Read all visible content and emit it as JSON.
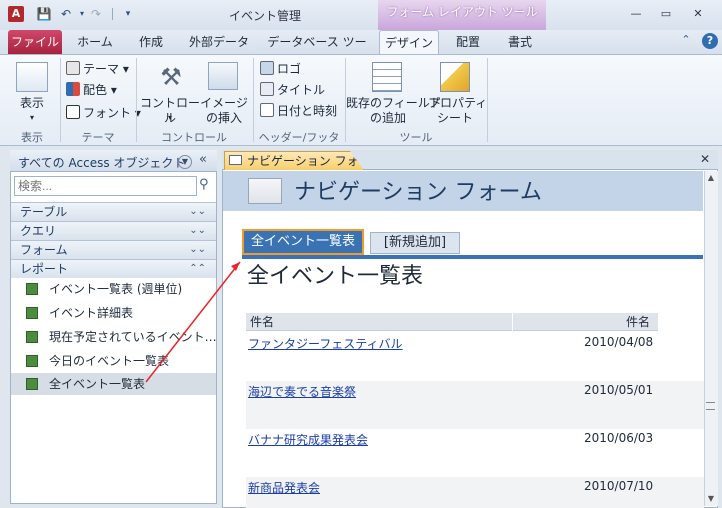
{
  "window": {
    "title": "イベント管理",
    "app_icon": "A",
    "context_tab_header": "フォーム レイアウト ツール"
  },
  "ribbon_tabs": [
    "ファイル",
    "ホーム",
    "作成",
    "外部データ",
    "データベース ツール",
    "デザイン",
    "配置",
    "書式"
  ],
  "ribbon": {
    "groups": [
      {
        "label": "表示",
        "buttons": [
          "表示"
        ]
      },
      {
        "label": "テーマ",
        "buttons": [
          "テーマ",
          "配色",
          "フォント"
        ]
      },
      {
        "label": "コントロール",
        "buttons": [
          "コントロール",
          "イメージ\nの挿入"
        ]
      },
      {
        "label": "ヘッダー/フッター",
        "buttons": [
          "ロゴ",
          "タイトル",
          "日付と時刻"
        ]
      },
      {
        "label": "ツール",
        "buttons": [
          "既存のフィールド\nの追加",
          "プロパティ\nシート"
        ]
      }
    ]
  },
  "nav": {
    "title": "すべての Access オブジェクト",
    "search_placeholder": "検索...",
    "groups": [
      "テーブル",
      "クエリ",
      "フォーム",
      "レポート"
    ],
    "items": [
      "イベント一覧表 (週単位)",
      "イベント詳細表",
      "現在予定されているイベント…",
      "今日のイベント一覧表",
      "全イベント一覧表"
    ]
  },
  "document": {
    "tab": "ナビゲーション フォーム",
    "form_title": "ナビゲーション フォーム",
    "nav_tabs": [
      "全イベント一覧表",
      "[新規追加]"
    ],
    "report_title": "全イベント一覧表",
    "columns": [
      "件名",
      "件名"
    ],
    "rows": [
      {
        "name": "ファンタジーフェスティバル",
        "date": "2010/04/08"
      },
      {
        "name": "海辺で奏でる音楽祭",
        "date": "2010/05/01"
      },
      {
        "name": "バナナ研究成果発表会",
        "date": "2010/06/03"
      },
      {
        "name": "新商品発表会",
        "date": "2010/07/10"
      }
    ]
  },
  "colors": {
    "file_tab": "#b82d4d",
    "nav_tab_active": "#3a73b4",
    "highlight_border": "#f19b2c",
    "annotation_arrow": "#e8262a"
  }
}
